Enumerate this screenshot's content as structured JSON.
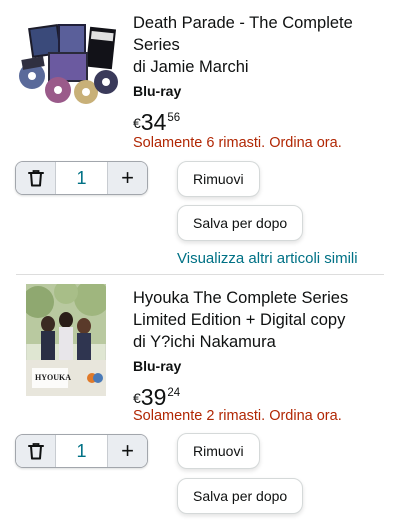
{
  "cart_items": [
    {
      "title": "Death Parade - The Complete Series",
      "author": "di Jamie Marchi",
      "format": "Blu-ray",
      "price": {
        "currency": "€",
        "whole": "34",
        "fraction": "56"
      },
      "stock": "Solamente 6 rimasti. Ordina ora.",
      "quantity": "1",
      "remove_label": "Rimuovi",
      "save_label": "Salva per dopo",
      "similar_label": "Visualizza altri articoli simili"
    },
    {
      "title": "Hyouka The Complete Series Limited Edition + Digital copy",
      "author": "di Y?ichi Nakamura",
      "format": "Blu-ray",
      "price": {
        "currency": "€",
        "whole": "39",
        "fraction": "24"
      },
      "stock": "Solamente 2 rimasti. Ordina ora.",
      "quantity": "1",
      "remove_label": "Rimuovi",
      "save_label": "Salva per dopo",
      "cover_text": "HYOUKA"
    }
  ],
  "icons": {
    "delete": "trash-icon",
    "increase": "plus-icon"
  }
}
